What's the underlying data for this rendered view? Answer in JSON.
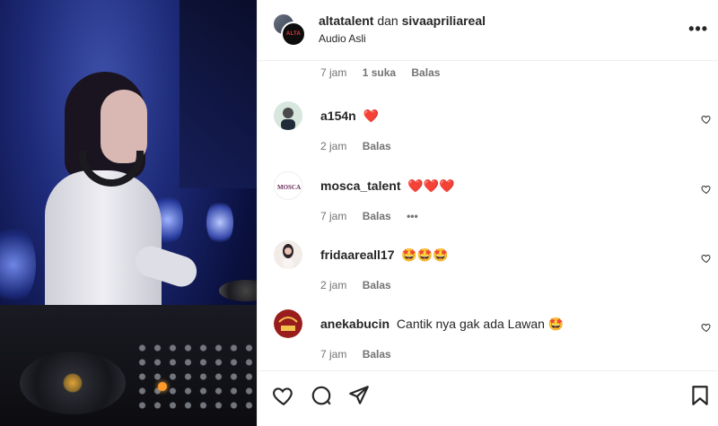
{
  "header": {
    "user1": "altatalent",
    "connector": "dan",
    "user2": "sivaaprilia real",
    "user2_display": "sivaapriliareal",
    "subtitle": "Audio Asli",
    "avatar_logo": "ALTA",
    "more_icon": "more-horizontal-icon"
  },
  "top_meta": {
    "time": "7 jam",
    "likes": "1 suka",
    "reply": "Balas"
  },
  "comments": [
    {
      "user": "a154n",
      "text": "❤️",
      "time": "2 jam",
      "reply": "Balas"
    },
    {
      "user": "mosca_talent",
      "text": "❤️❤️❤️",
      "time": "7 jam",
      "reply": "Balas",
      "extra": "•••"
    },
    {
      "user": "fridaareall17",
      "text": "🤩🤩🤩",
      "time": "2 jam",
      "reply": "Balas"
    },
    {
      "user": "anekabucin",
      "text": "Cantik nya gak ada Lawan 🤩",
      "time": "7 jam",
      "reply": "Balas"
    }
  ],
  "avatar_labels": {
    "mosca": "MOSCA"
  },
  "actions": [
    "heart-icon",
    "comment-icon",
    "share-icon",
    "bookmark-icon"
  ],
  "colors": {
    "accent": "#e0245e",
    "muted": "#737373",
    "text": "#262626"
  }
}
